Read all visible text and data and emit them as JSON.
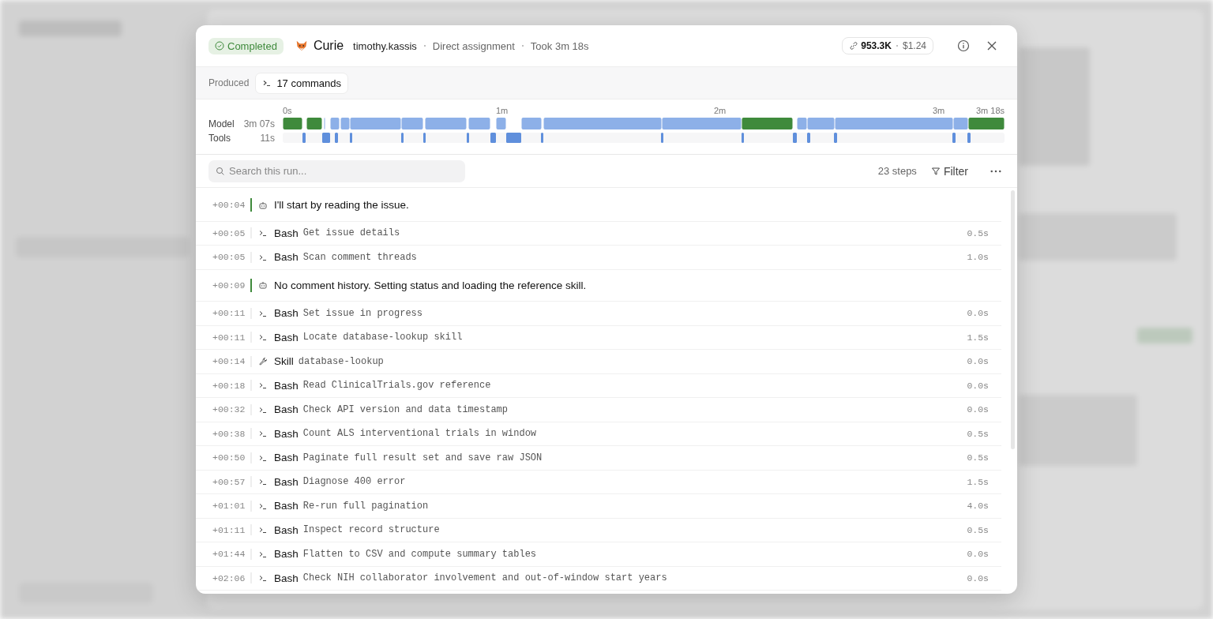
{
  "header": {
    "status": "Completed",
    "agent": "Curie",
    "user": "timothy.kassis",
    "assignment": "Direct assignment",
    "duration": "Took 3m 18s",
    "tokens": "953.3K",
    "cost": "$1.24"
  },
  "produced": {
    "label": "Produced",
    "output": "17 commands"
  },
  "timeline": {
    "ticks": [
      "0s",
      "1m",
      "2m",
      "3m",
      "3m 18s"
    ],
    "tracks": [
      {
        "kind": "model",
        "label": "Model",
        "total": "3m 07s"
      },
      {
        "kind": "tools",
        "label": "Tools",
        "total": "11s"
      }
    ]
  },
  "toolbar": {
    "placeholder": "Search this run...",
    "steps": "23 steps",
    "filter": "Filter"
  },
  "steps": [
    {
      "kind": "message",
      "time": "+00:04",
      "text": "I'll start by reading the issue."
    },
    {
      "kind": "bash",
      "time": "+00:05",
      "tool": "Bash",
      "text": "Get issue details",
      "took": "0.5s"
    },
    {
      "kind": "bash",
      "time": "+00:05",
      "tool": "Bash",
      "text": "Scan comment threads",
      "took": "1.0s"
    },
    {
      "kind": "message",
      "time": "+00:09",
      "text": "No comment history. Setting status and loading the reference skill."
    },
    {
      "kind": "bash",
      "time": "+00:11",
      "tool": "Bash",
      "text": "Set issue in progress",
      "took": "0.0s"
    },
    {
      "kind": "bash",
      "time": "+00:11",
      "tool": "Bash",
      "text": "Locate database-lookup skill",
      "took": "1.5s"
    },
    {
      "kind": "skill",
      "time": "+00:14",
      "tool": "Skill",
      "text": "database-lookup",
      "took": "0.0s"
    },
    {
      "kind": "bash",
      "time": "+00:18",
      "tool": "Bash",
      "text": "Read ClinicalTrials.gov reference",
      "took": "0.0s"
    },
    {
      "kind": "bash",
      "time": "+00:32",
      "tool": "Bash",
      "text": "Check API version and data timestamp",
      "took": "0.0s"
    },
    {
      "kind": "bash",
      "time": "+00:38",
      "tool": "Bash",
      "text": "Count ALS interventional trials in window",
      "took": "0.5s"
    },
    {
      "kind": "bash",
      "time": "+00:50",
      "tool": "Bash",
      "text": "Paginate full result set and save raw JSON",
      "took": "0.5s"
    },
    {
      "kind": "bash",
      "time": "+00:57",
      "tool": "Bash",
      "text": "Diagnose 400 error",
      "took": "1.5s"
    },
    {
      "kind": "bash",
      "time": "+01:01",
      "tool": "Bash",
      "text": "Re-run full pagination",
      "took": "4.0s"
    },
    {
      "kind": "bash",
      "time": "+01:11",
      "tool": "Bash",
      "text": "Inspect record structure",
      "took": "0.5s"
    },
    {
      "kind": "bash",
      "time": "+01:44",
      "tool": "Bash",
      "text": "Flatten to CSV and compute summary tables",
      "took": "0.0s"
    },
    {
      "kind": "bash",
      "time": "+02:06",
      "tool": "Bash",
      "text": "Check NIH collaborator involvement and out-of-window start years",
      "took": "0.0s"
    }
  ]
}
